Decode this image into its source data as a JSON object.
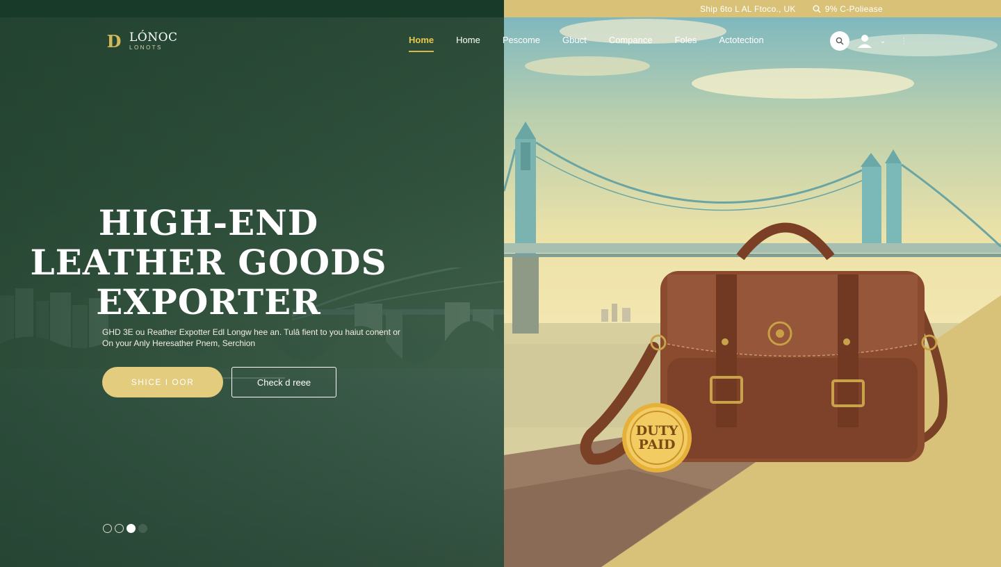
{
  "topbar": {
    "shipping_text": "Ship 6to L AL Ftoco., UK",
    "promo_text": "9% C-Poliease"
  },
  "brand": {
    "logo_mark": "D",
    "name": "LÓNOC",
    "tagline": "LONOTS"
  },
  "nav": {
    "items": [
      {
        "label": "Home",
        "active": true
      },
      {
        "label": "Home",
        "active": false
      },
      {
        "label": "Pescome",
        "active": false
      },
      {
        "label": "Gbuct",
        "active": false
      },
      {
        "label": "Compance",
        "active": false
      },
      {
        "label": "Foles",
        "active": false
      },
      {
        "label": "Actotection",
        "active": false
      }
    ]
  },
  "hero": {
    "title_lines": [
      "HIGH-END",
      "LEATHER GOODS",
      "EXPORTER"
    ],
    "description_lines": [
      "GHD 3E ou Reather Expotter Edl Longw hee an. Tulâ fient to you haiut conent or",
      "On your Anly Heresather Pnem, Serchion"
    ],
    "primary_button": "SHICE I OOR",
    "secondary_button": "Check d reee"
  },
  "slider": {
    "total": 4,
    "active_index": 2
  },
  "badge": {
    "line1": "DUTY",
    "line2": "PAID"
  },
  "colors": {
    "brand_green": "#173b28",
    "gold_accent": "#d9c278",
    "button_gold": "#e3cc7d",
    "nav_active": "#e8c84e",
    "leather_brown": "#8a4b2e"
  },
  "icons": [
    "search-icon",
    "user-icon",
    "chevron-down-icon",
    "more-icon"
  ]
}
